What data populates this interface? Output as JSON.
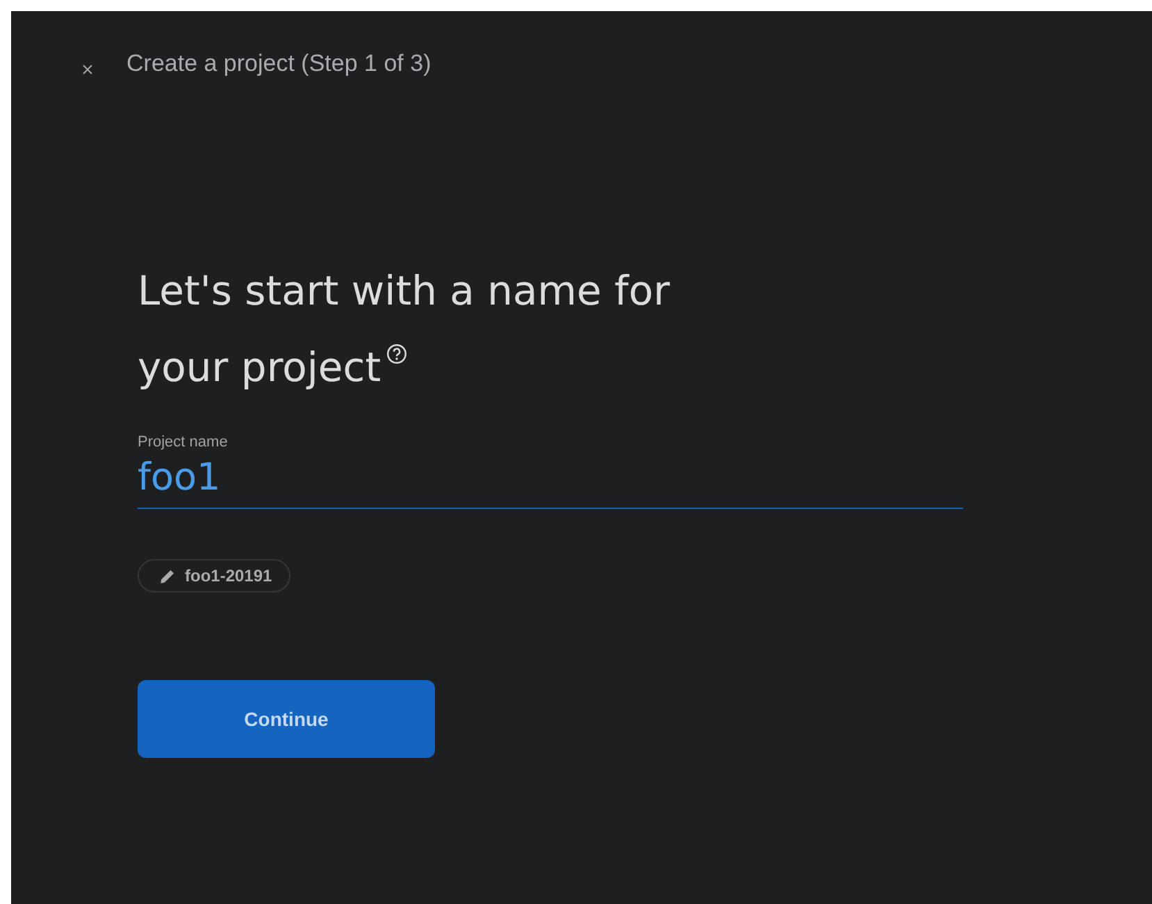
{
  "header": {
    "title": "Create a project (Step 1 of 3)"
  },
  "heading": {
    "line_1": "Let's start with a name for",
    "line_2": "your project"
  },
  "project_name_field": {
    "label": "Project name",
    "value": "foo1"
  },
  "project_id_chip": {
    "text": "foo1-20191"
  },
  "continue_button": {
    "label": "Continue"
  }
}
